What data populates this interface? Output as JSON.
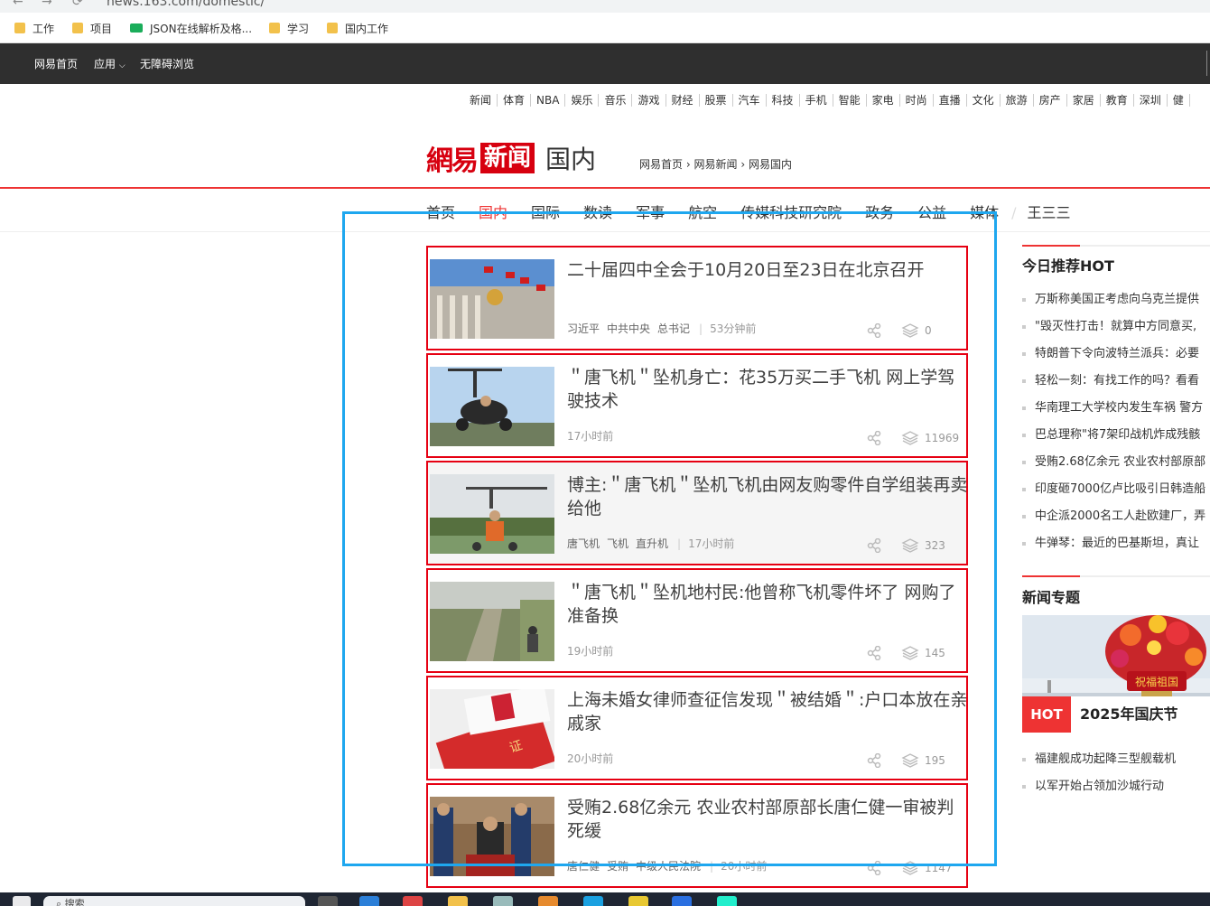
{
  "browser": {
    "url": "news.163.com/domestic/",
    "bookmarks": [
      "工作",
      "项目",
      "JSON在线解析及格...",
      "学习",
      "国内工作"
    ]
  },
  "topbar": {
    "items": [
      "网易首页",
      "应用",
      "无障碍浏览"
    ]
  },
  "channels": [
    "新闻",
    "体育",
    "NBA",
    "娱乐",
    "音乐",
    "游戏",
    "财经",
    "股票",
    "汽车",
    "科技",
    "手机",
    "智能",
    "家电",
    "时尚",
    "直播",
    "文化",
    "旅游",
    "房产",
    "家居",
    "教育",
    "深圳",
    "健"
  ],
  "logo": {
    "brand": "網易",
    "product": "新闻",
    "section": "国内"
  },
  "breadcrumb": [
    "网易首页",
    "网易新闻",
    "网易国内"
  ],
  "mainnav": [
    "首页",
    "国内",
    "国际",
    "数读",
    "军事",
    "航空",
    "传媒科技研究院",
    "政务",
    "公益",
    "媒体",
    "王三三"
  ],
  "news": [
    {
      "title": "二十届四中全会于10月20日至23日在北京召开",
      "tags": [
        "习近平",
        "中共中央",
        "总书记"
      ],
      "time": "53分钟前",
      "comments": "0"
    },
    {
      "title": "＂唐飞机＂坠机身亡：花35万买二手飞机 网上学驾驶技术",
      "tags": [],
      "time": "17小时前",
      "comments": "11969"
    },
    {
      "title": "博主:＂唐飞机＂坠机飞机由网友购零件自学组装再卖给他",
      "tags": [
        "唐飞机",
        "飞机",
        "直升机"
      ],
      "time": "17小时前",
      "comments": "323"
    },
    {
      "title": "＂唐飞机＂坠机地村民:他曾称飞机零件坏了 网购了准备换",
      "tags": [],
      "time": "19小时前",
      "comments": "145"
    },
    {
      "title": "上海未婚女律师查征信发现＂被结婚＂:户口本放在亲戚家",
      "tags": [],
      "time": "20小时前",
      "comments": "195"
    },
    {
      "title": "受贿2.68亿余元 农业农村部原部长唐仁健一审被判死缓",
      "tags": [
        "唐仁健",
        "受贿",
        "中级人民法院"
      ],
      "time": "20小时前",
      "comments": "1147"
    }
  ],
  "sidebar": {
    "hot_title": "今日推荐HOT",
    "hot_items": [
      "万斯称美国正考虑向乌克兰提供",
      "\"毁灭性打击！就算中方同意买,",
      "特朗普下令向波特兰派兵：必要",
      "轻松一刻：有找工作的吗？看看",
      "华南理工大学校内发生车祸 警方",
      "巴总理称\"将7架印战机炸成残骸",
      "受贿2.68亿余元 农业农村部原部",
      "印度砸7000亿卢比吸引日韩造船",
      "中企派2000名工人赴欧建厂，弄",
      "牛弹琴：最近的巴基斯坦，真让"
    ],
    "topic_title": "新闻专题",
    "topic_badge": "HOT",
    "topic_name": "2025年国庆节",
    "topic_banner": "祝福祖国",
    "topic_items": [
      "福建舰成功起降三型舰载机",
      "以军开始占领加沙城行动"
    ]
  },
  "taskbar": {
    "search_placeholder": "搜索"
  },
  "colors": {
    "brand_red": "#d7000f",
    "selection_blue": "#1ea7ef",
    "topbar": "#2f2f2f"
  }
}
